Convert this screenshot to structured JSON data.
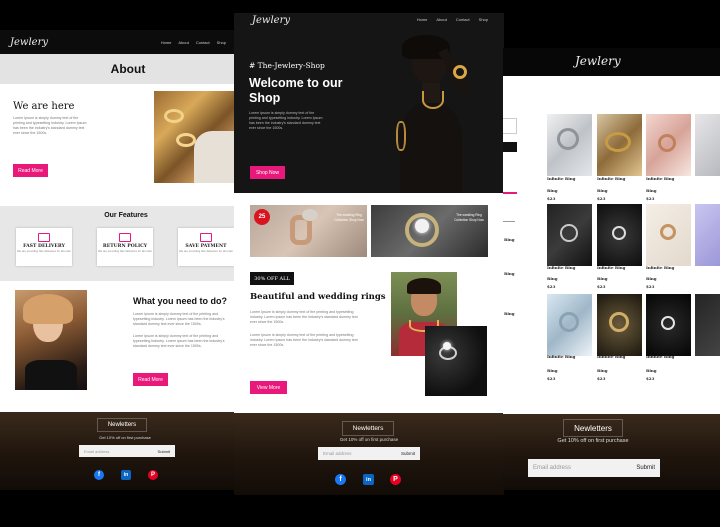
{
  "left": {
    "logo": "Jewlery",
    "nav": [
      "Home",
      "About",
      "Contact",
      "Shop"
    ],
    "about_title": "About",
    "we_are_here": "We are here",
    "about_text": "Lorem Ipsum is simply dummy text of the printing and typesetting industry. Lorem Ipsum has been the industry's standard dummy text ever since the 1500s.",
    "read_more": "Read More",
    "features_title": "Our Features",
    "features": [
      {
        "title": "FAST DELIVERY",
        "desc": "We are providing fast deliveries for all order",
        "icon": "truck-icon"
      },
      {
        "title": "RETURN POLICY",
        "desc": "We are providing fast deliveries for all order",
        "icon": "return-icon"
      },
      {
        "title": "SAVE PAYMENT",
        "desc": "We are providing fast deliveries for all order",
        "icon": "payment-icon"
      }
    ],
    "need_title": "What you need to do?",
    "need_p1": "Lorem Ipsum is simply dummy text of the printing and typesetting industry. Lorem Ipsum has been the industry's standard dummy text ever since the 1500s.",
    "need_p2": "Lorem Ipsum is simply dummy text of the printing and typesetting industry. Lorem Ipsum has been the industry's standard dummy text ever since the 1500s.",
    "read_more_2": "Read More",
    "newsletter": {
      "title": "Newletters",
      "sub": "Get 10% off on first purchase",
      "placeholder": "Email address",
      "submit": "Submit"
    }
  },
  "center": {
    "logo": "Jewlery",
    "nav": [
      "Home",
      "About",
      "Contact",
      "Shop"
    ],
    "tag": "# The-Jewlery-Shop",
    "welcome": "Welcome to our Shop",
    "hero_text": "Lorem Ipsum is simply dummy text of the printing and typesetting industry. Lorem Ipsum has been the industry's standard dummy text ever since the 1500s.",
    "shop_now": "Shop Now",
    "badge": "25",
    "promo1": "The wedding Ring Collection Shop Now",
    "promo2": "The wedding Ring Collection Shop Now",
    "off_badge": "30% OFF ALL",
    "beautiful_title": "Beautiful and wedding rings",
    "text1": "Lorem Ipsum is simply dummy text of the printing and typesetting industry. Lorem Ipsum has been the industry's standard dummy text ever since the 1500s.",
    "text2": "Lorem Ipsum is simply dummy text of the printing and typesetting industry. Lorem Ipsum has been the industry's standard dummy text ever since the 1500s.",
    "view_more": "View More",
    "newsletter": {
      "title": "Newletters",
      "sub": "Get 10% off on first purchase",
      "placeholder": "Email address",
      "submit": "Submit"
    }
  },
  "right": {
    "logo": "Jewlery",
    "side_labels": [
      "Ring",
      "Ring",
      "Ring"
    ],
    "products": [
      {
        "name": "Infinite Ring",
        "type": "Ring",
        "price": "$23"
      },
      {
        "name": "Infinite Ring",
        "type": "Ring",
        "price": "$23"
      },
      {
        "name": "Infinite Ring",
        "type": "Ring",
        "price": "$23"
      },
      {
        "name": "Infinite Ring",
        "type": "Ring",
        "price": "$23"
      },
      {
        "name": "Infinite Ring",
        "type": "Ring",
        "price": "$23"
      },
      {
        "name": "Infinite Ring",
        "type": "Ring",
        "price": "$23"
      },
      {
        "name": "Infinite Ring",
        "type": "Ring",
        "price": "$23"
      },
      {
        "name": "Infinite Ring",
        "type": "Ring",
        "price": "$23"
      },
      {
        "name": "Infinite Ring",
        "type": "Ring",
        "price": "$23"
      }
    ],
    "newsletter": {
      "title": "Newletters",
      "sub": "Get 10% off on first purchase",
      "placeholder": "Email address",
      "submit": "Submit"
    }
  },
  "colors": {
    "accent": "#e8197a",
    "dark": "#111111",
    "footer": "#2a1d12"
  }
}
